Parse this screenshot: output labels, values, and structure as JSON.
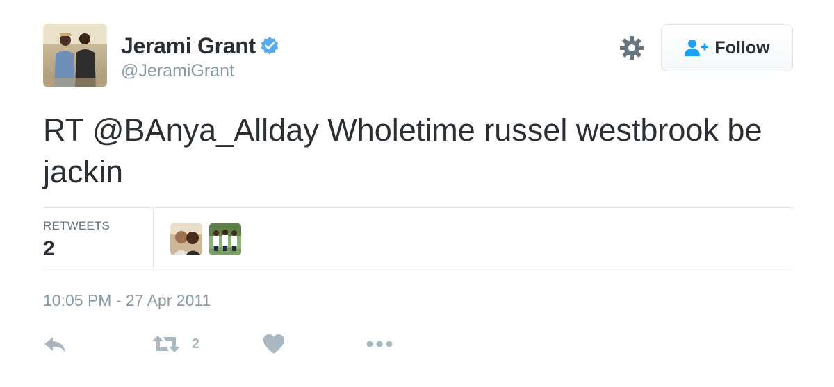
{
  "user": {
    "full_name": "Jerami Grant",
    "screen_name": "@JeramiGrant",
    "verified": true
  },
  "header": {
    "follow_label": "Follow"
  },
  "tweet": {
    "mention": "RT @BAnya_Allday",
    "body": " Wholetime russel westbrook be jackin"
  },
  "stats": {
    "retweets_label": "RETWEETS",
    "retweets_count": "2"
  },
  "timestamp": "10:05 PM - 27 Apr 2011",
  "actions": {
    "retweet_count": "2"
  },
  "colors": {
    "text": "#292f33",
    "muted": "#8899a6",
    "verified_blue": "#55acee",
    "follow_icon_blue": "#1da1f2",
    "action_gray": "#aab8c2",
    "divider": "#e1e8ed"
  },
  "icons": {
    "verified": "verified-badge-icon",
    "gear": "gear-icon",
    "follow": "follow-person-plus-icon",
    "reply": "reply-icon",
    "retweet": "retweet-icon",
    "like": "heart-icon",
    "more": "more-dots-icon"
  }
}
